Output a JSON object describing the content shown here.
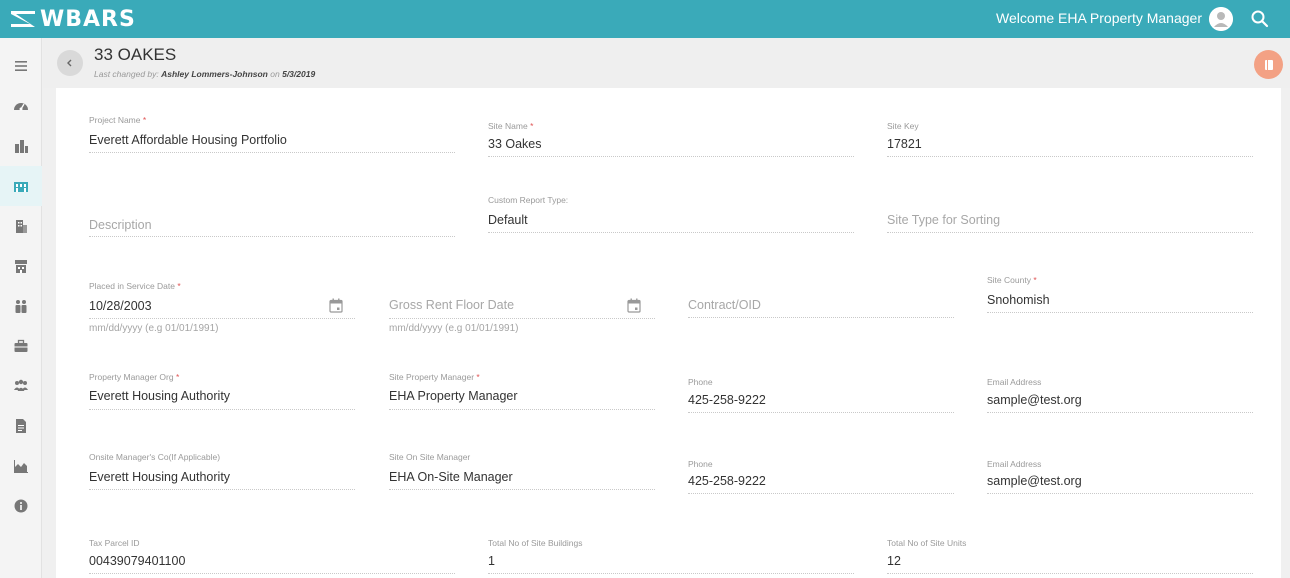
{
  "app": {
    "brand": "WBARS"
  },
  "topbar": {
    "welcome_text": "Welcome EHA Property Manager"
  },
  "sidebar": {
    "items": [
      {
        "icon": "menu-icon"
      },
      {
        "icon": "dashboard-icon"
      },
      {
        "icon": "buildings-icon"
      },
      {
        "icon": "site-icon",
        "active": true
      },
      {
        "icon": "building-icon"
      },
      {
        "icon": "storefront-icon"
      },
      {
        "icon": "people-icon"
      },
      {
        "icon": "briefcase-icon"
      },
      {
        "icon": "group-icon"
      },
      {
        "icon": "document-icon"
      },
      {
        "icon": "area-chart-icon"
      },
      {
        "icon": "info-icon"
      }
    ]
  },
  "header": {
    "title": "33 OAKES",
    "last_changed_prefix": "Last changed by:",
    "last_changed_user": "Ashley Lommers-Johnson",
    "last_changed_on": "on",
    "last_changed_date": "5/3/2019"
  },
  "colors": {
    "accent": "#3aaab9",
    "fab": "#f3a184",
    "required": "#e05555"
  },
  "form": {
    "required_mark": "*",
    "project_name": {
      "label": "Project Name",
      "value": "Everett Affordable Housing Portfolio"
    },
    "site_name": {
      "label": "Site Name",
      "value": "33 Oakes"
    },
    "site_key": {
      "label": "Site Key",
      "value": "17821"
    },
    "description": {
      "placeholder": "Description"
    },
    "custom_report_type": {
      "label": "Custom Report Type:",
      "value": "Default"
    },
    "site_type_sorting": {
      "placeholder": "Site Type for Sorting"
    },
    "placed_in_service": {
      "label": "Placed in Service Date",
      "value": "10/28/2003",
      "hint": "mm/dd/yyyy (e.g 01/01/1991)"
    },
    "gross_rent_floor": {
      "placeholder": "Gross Rent Floor Date",
      "hint": "mm/dd/yyyy (e.g 01/01/1991)"
    },
    "contract_oid": {
      "placeholder": "Contract/OID"
    },
    "site_county": {
      "label": "Site County",
      "value": "Snohomish"
    },
    "property_manager_org": {
      "label": "Property Manager Org",
      "value": "Everett Housing Authority"
    },
    "site_property_manager": {
      "label": "Site Property Manager",
      "value": "EHA Property Manager"
    },
    "phone_1": {
      "label": "Phone",
      "value": "425-258-9222"
    },
    "email_1": {
      "label": "Email Address",
      "value": "sample@test.org"
    },
    "onsite_managers_co": {
      "label": "Onsite Manager's Co(If Applicable)",
      "value": "Everett Housing Authority"
    },
    "site_onsite_manager": {
      "label": "Site On Site Manager",
      "value": "EHA On-Site Manager"
    },
    "phone_2": {
      "label": "Phone",
      "value": "425-258-9222"
    },
    "email_2": {
      "label": "Email Address",
      "value": "sample@test.org"
    },
    "tax_parcel_id": {
      "label": "Tax Parcel ID",
      "value": "00439079401100"
    },
    "total_site_buildings": {
      "label": "Total No of Site Buildings",
      "value": "1"
    },
    "total_site_units": {
      "label": "Total No of Site Units",
      "value": "12"
    }
  }
}
